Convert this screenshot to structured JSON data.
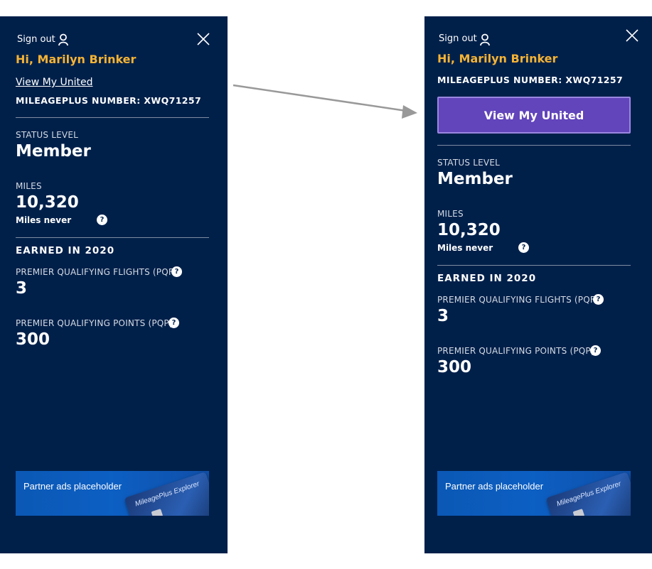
{
  "menu": {
    "sign_out_label": "Sign out",
    "greeting": "Hi, Marilyn Brinker",
    "view_link_label": "View My United",
    "mileageplus_label": "MILEAGEPLUS NUMBER: XWQ71257",
    "status_label": "STATUS LEVEL",
    "status_value": "Member",
    "miles_label": "MILES",
    "miles_value": "10,320",
    "miles_note": "Miles never",
    "earned_heading": "EARNED IN 2020",
    "pqf_label": "PREMIER QUALIFYING FLIGHTS (PQF)",
    "pqf_value": "3",
    "pqp_label": "PREMIER QUALIFYING POINTS (PQP)",
    "pqp_value": "300",
    "help_glyph": "?",
    "ad_text": "Partner ads placeholder",
    "ad_card_text": "MileagePlus Explorer"
  },
  "icons": {
    "user": "user-icon",
    "close": "close-icon",
    "help": "question-mark-icon",
    "arrow": "arrow-right-icon"
  },
  "colors": {
    "panel_bg": "#00204a",
    "greeting": "#f5b335",
    "button_bg": "#6244bb",
    "divider": "#7f8ba1",
    "arrow": "#999999"
  }
}
